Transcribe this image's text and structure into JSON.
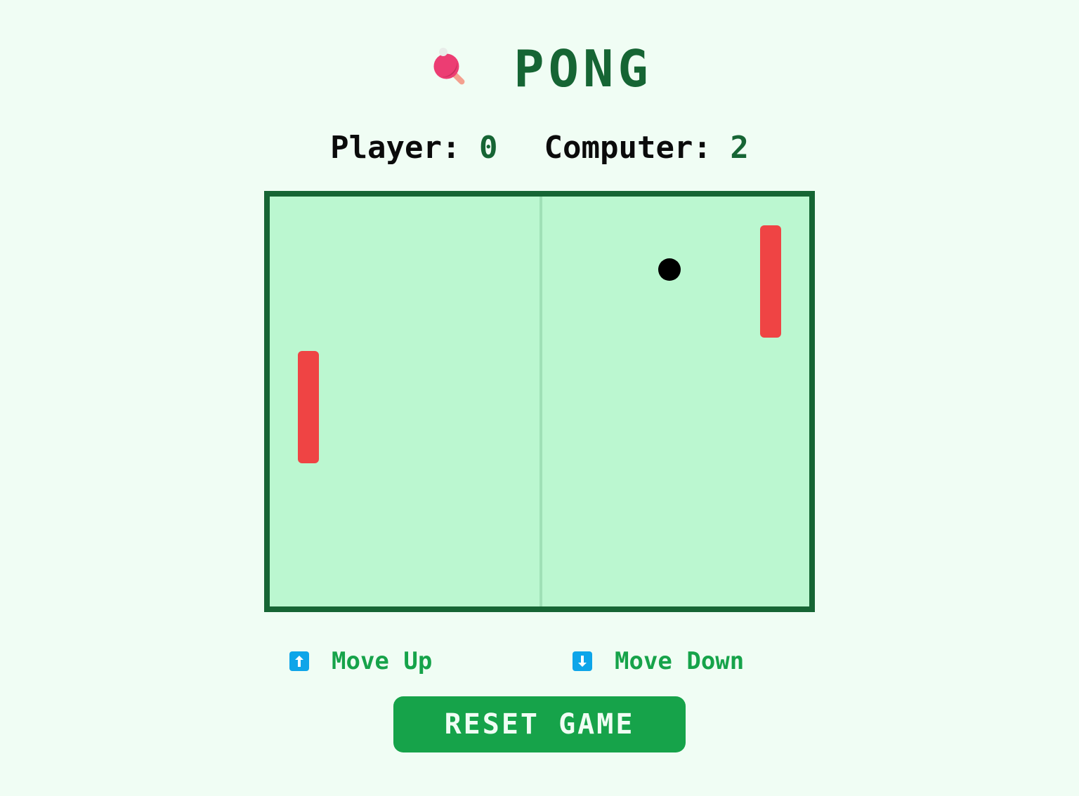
{
  "title": {
    "icon": "ping-pong-paddle-icon",
    "text": "PONG"
  },
  "score": {
    "player_label": "Player: ",
    "player_value": "0",
    "computer_label": "Computer: ",
    "computer_value": "2"
  },
  "board": {
    "ball_color": "#000000",
    "paddle_color": "#ef4444",
    "table_color": "#bbf7d0",
    "border_color": "#166534"
  },
  "controls": {
    "up": {
      "icon": "up-arrow-key-icon",
      "label": "Move Up"
    },
    "down": {
      "icon": "down-arrow-key-icon",
      "label": "Move Down"
    }
  },
  "reset_button": {
    "label": "RESET GAME"
  },
  "colors": {
    "background": "#f0fdf4",
    "accent": "#16a34a",
    "dark_accent": "#166534",
    "icon_blue": "#0ea5e9"
  }
}
